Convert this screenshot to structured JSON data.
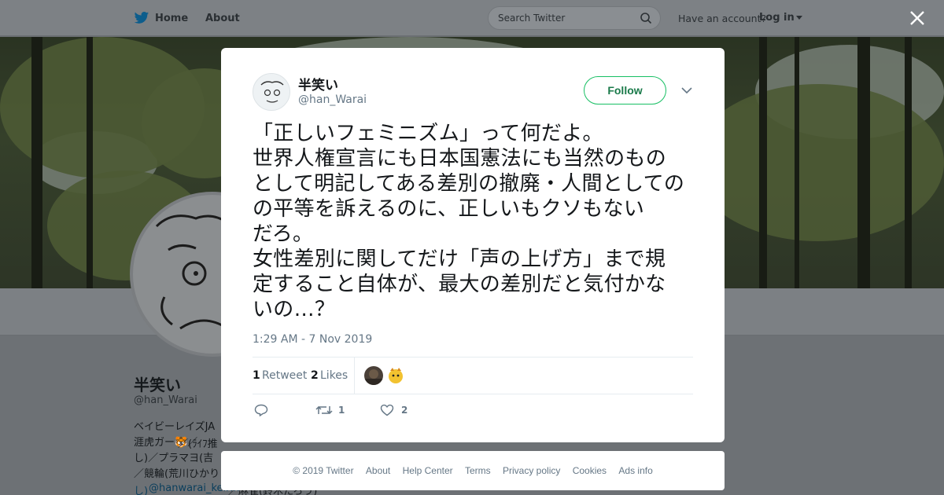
{
  "nav": {
    "home": "Home",
    "about": "About",
    "search_placeholder": "Search Twitter",
    "have_account": "Have an account?",
    "login": "Log in"
  },
  "profile": {
    "name": "半笑い",
    "handle": "@han_Warai",
    "bio_lines": [
      "ベイビーレイズJA",
      "涯虎ガー🐯／",
      "し)／プラマヨ(吉",
      "／競輪(荒川ひかり",
      "し)"
    ],
    "bio_link": "@hanwarai_keirin",
    "bio_tail": "／(ﾗｲﾌ推",
    "bio_tail2": "／麻雀(鈴木たろう)"
  },
  "tweet": {
    "author_name": "半笑い",
    "author_handle": "@han_Warai",
    "follow_label": "Follow",
    "text": "「正しいフェミニズム」って何だよ。\n世界人権宣言にも日本国憲法にも当然のもの\nとして明記してある差別の撤廃・人間としての\nの平等を訴えるのに、正しいもクソもない\nだろ。\n女性差別に関してだけ「声の上げ方」まで規\n定すること自体が、最大の差別だと気付かな\nいの…？",
    "timestamp": "1:29 AM - 7 Nov 2019",
    "retweet_count": "1",
    "retweet_label": "Retweet",
    "like_count": "2",
    "like_label": "Likes",
    "action_retweets": "1",
    "action_likes": "2"
  },
  "footer": {
    "links": [
      "© 2019 Twitter",
      "About",
      "Help Center",
      "Terms",
      "Privacy policy",
      "Cookies",
      "Ads info"
    ]
  },
  "colors": {
    "accent_follow": "#17bf63",
    "text_primary": "#14171a",
    "text_secondary": "#657786",
    "twitter_blue": "#1da1f2"
  }
}
